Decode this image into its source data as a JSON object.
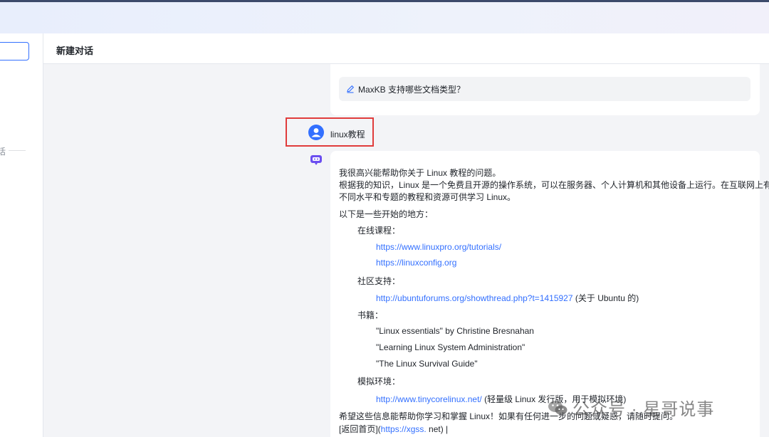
{
  "header": {
    "title": "新建对话"
  },
  "sidebar": {
    "divider_text": "话"
  },
  "previous": {
    "suggestion": "MaxKB 支持哪些文档类型？"
  },
  "user_message": {
    "text": "linux教程"
  },
  "answer": {
    "intro1": "我很高兴能帮助你关于 Linux 教程的问题。",
    "intro2a": "根据我的知识，Linux 是一个免费且开源的操作系统，可以在服务器、个人计算机和其他设备上运行。在互联网上有许多",
    "intro2b": "不同水平和专题的教程和资源可供学习 Linux。",
    "lead": "以下是一些开始的地方：",
    "sec_online": "在线课程：",
    "link1": "https://www.linuxpro.org/tutorials/",
    "link2": "https://linuxconfig.org",
    "sec_community": "社区支持：",
    "link3": "http://ubuntuforums.org/showthread.php?t=1415927",
    "link3_note": " (关于 Ubuntu 的)",
    "sec_books": "书籍：",
    "book1": "\"Linux essentials\" by Christine Bresnahan",
    "book2": "\"Learning Linux System Administration\"",
    "book3": "\"The Linux Survival Guide\"",
    "sec_sim": "模拟环境：",
    "link4": "http://www.tinycorelinux.net/",
    "link4_note": " (轻量级 Linux 发行版，用于模拟环境)",
    "closing": "希望这些信息能帮助你学习和掌握 Linux！如果有任何进一步的问题或疑惑，请随时提问。",
    "back_prefix": "[返回首页](",
    "back_link": "https://xgss.",
    "back_suffix": " net) |"
  },
  "watermark": {
    "text": "公众号 · 星哥说事"
  },
  "colors": {
    "accent": "#3370ff",
    "highlight_border": "#e03c3c",
    "bot_icon": "#6b4ef0"
  }
}
